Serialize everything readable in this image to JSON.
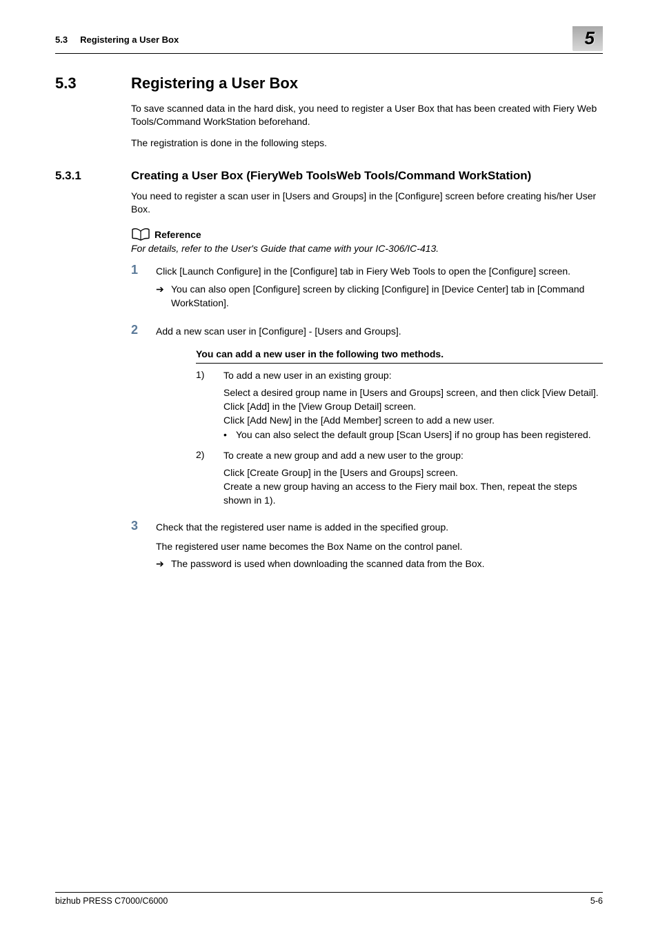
{
  "header": {
    "section_number_short": "5.3",
    "section_title_short": "Registering a User Box",
    "chapter_number": "5"
  },
  "section": {
    "number": "5.3",
    "title": "Registering a User Box",
    "intro_para1": "To save scanned data in the hard disk, you need to register a User Box that has been created with Fiery Web Tools/Command WorkStation beforehand.",
    "intro_para2": "The registration is done in the following steps."
  },
  "subsection": {
    "number": "5.3.1",
    "title": "Creating a User Box (FieryWeb ToolsWeb Tools/Command WorkStation)",
    "intro": "You need to register a scan user in  [Users and Groups] in the [Configure] screen before creating his/her User Box."
  },
  "reference": {
    "label": "Reference",
    "text": "For details, refer to the User's Guide that came with your IC-306/IC-413."
  },
  "steps": [
    {
      "num": "1",
      "text": "Click [Launch Configure] in the [Configure] tab in Fiery Web Tools to open the [Configure] screen.",
      "sub": "You can also open [Configure] screen by clicking [Configure] in [Device Center] tab in [Command WorkStation]."
    },
    {
      "num": "2",
      "text": "Add a new scan user in [Configure] - [Users and Groups].",
      "methods": {
        "title": "You can add a new user in the following two methods.",
        "items": [
          {
            "num": "1)",
            "head": "To add a new user in an existing group:",
            "body_line1": "Select a desired group name in [Users and Groups] screen, and then click [View Detail].",
            "body_line2": "Click [Add] in the [View Group Detail] screen.",
            "body_line3": "Click [Add New] in the [Add Member] screen to add a new user.",
            "bullet": "You can also select the default group [Scan Users] if no group has been registered."
          },
          {
            "num": "2)",
            "head": "To create a new group and add a new user to the group:",
            "body_line1": "Click [Create Group] in the [Users and Groups] screen.",
            "body_line2": "Create a new group having an access to the Fiery mail box. Then, repeat the steps shown in 1)."
          }
        ]
      }
    },
    {
      "num": "3",
      "text": "Check that the registered user name is added in the specified group.",
      "after_line": "The registered user name becomes the Box Name on the control panel.",
      "sub": "The password is used when downloading the scanned data from the Box."
    }
  ],
  "footer": {
    "product": "bizhub PRESS C7000/C6000",
    "page": "5-6"
  }
}
